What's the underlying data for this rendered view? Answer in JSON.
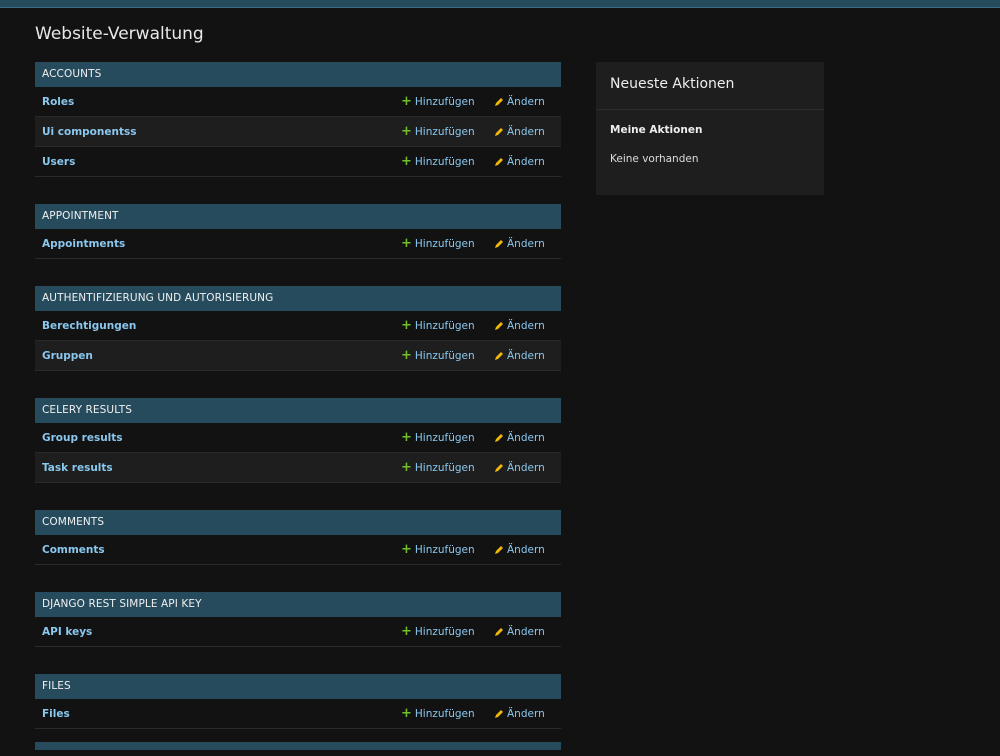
{
  "page": {
    "title": "Website-Verwaltung"
  },
  "actions": {
    "add_label": "Hinzufügen",
    "change_label": "Ändern"
  },
  "modules": [
    {
      "name": "ACCOUNTS",
      "models": [
        "Roles",
        "Ui componentss",
        "Users"
      ]
    },
    {
      "name": "APPOINTMENT",
      "models": [
        "Appointments"
      ]
    },
    {
      "name": "AUTHENTIFIZIERUNG UND AUTORISIERUNG",
      "models": [
        "Berechtigungen",
        "Gruppen"
      ]
    },
    {
      "name": "CELERY RESULTS",
      "models": [
        "Group results",
        "Task results"
      ]
    },
    {
      "name": "COMMENTS",
      "models": [
        "Comments"
      ]
    },
    {
      "name": "DJANGO REST SIMPLE API KEY",
      "models": [
        "API keys"
      ]
    },
    {
      "name": "FILES",
      "models": [
        "Files"
      ]
    }
  ],
  "recent_actions": {
    "title": "Neueste Aktionen",
    "subtitle": "Meine Aktionen",
    "empty_text": "Keine vorhanden"
  },
  "colors": {
    "header_bg": "#264b5d",
    "link": "#8ac8ef",
    "add_icon": "#70bf2b",
    "change_icon": "#efb80b"
  }
}
